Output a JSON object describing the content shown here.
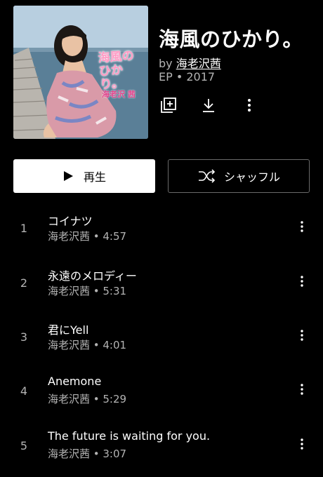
{
  "album": {
    "title": "海風のひかり。",
    "by_prefix": "by",
    "artist": "海老沢茜",
    "meta": "EP • 2017",
    "cover_title": "海風のひかり。",
    "cover_artist": "海老沢 茜"
  },
  "actions": {
    "add_icon": "library-add-icon",
    "download_icon": "download-icon",
    "more_icon": "more-vert-icon"
  },
  "buttons": {
    "play_label": "再生",
    "shuffle_label": "シャッフル"
  },
  "tracks": [
    {
      "number": "1",
      "title": "コイナツ",
      "subtitle": "海老沢茜 • 4:57"
    },
    {
      "number": "2",
      "title": "永遠のメロディー",
      "subtitle": "海老沢茜 • 5:31"
    },
    {
      "number": "3",
      "title": "君にYell",
      "subtitle": "海老沢茜 • 4:01"
    },
    {
      "number": "4",
      "title": "Anemone",
      "subtitle": "海老沢茜 • 5:29"
    },
    {
      "number": "5",
      "title": "The future is waiting for you.",
      "subtitle": "海老沢茜 • 3:07"
    }
  ],
  "colors": {
    "background": "#000000",
    "secondary_text": "#b3b3b3",
    "play_button_bg": "#ffffff",
    "shuffle_border": "#6a6a6a"
  }
}
